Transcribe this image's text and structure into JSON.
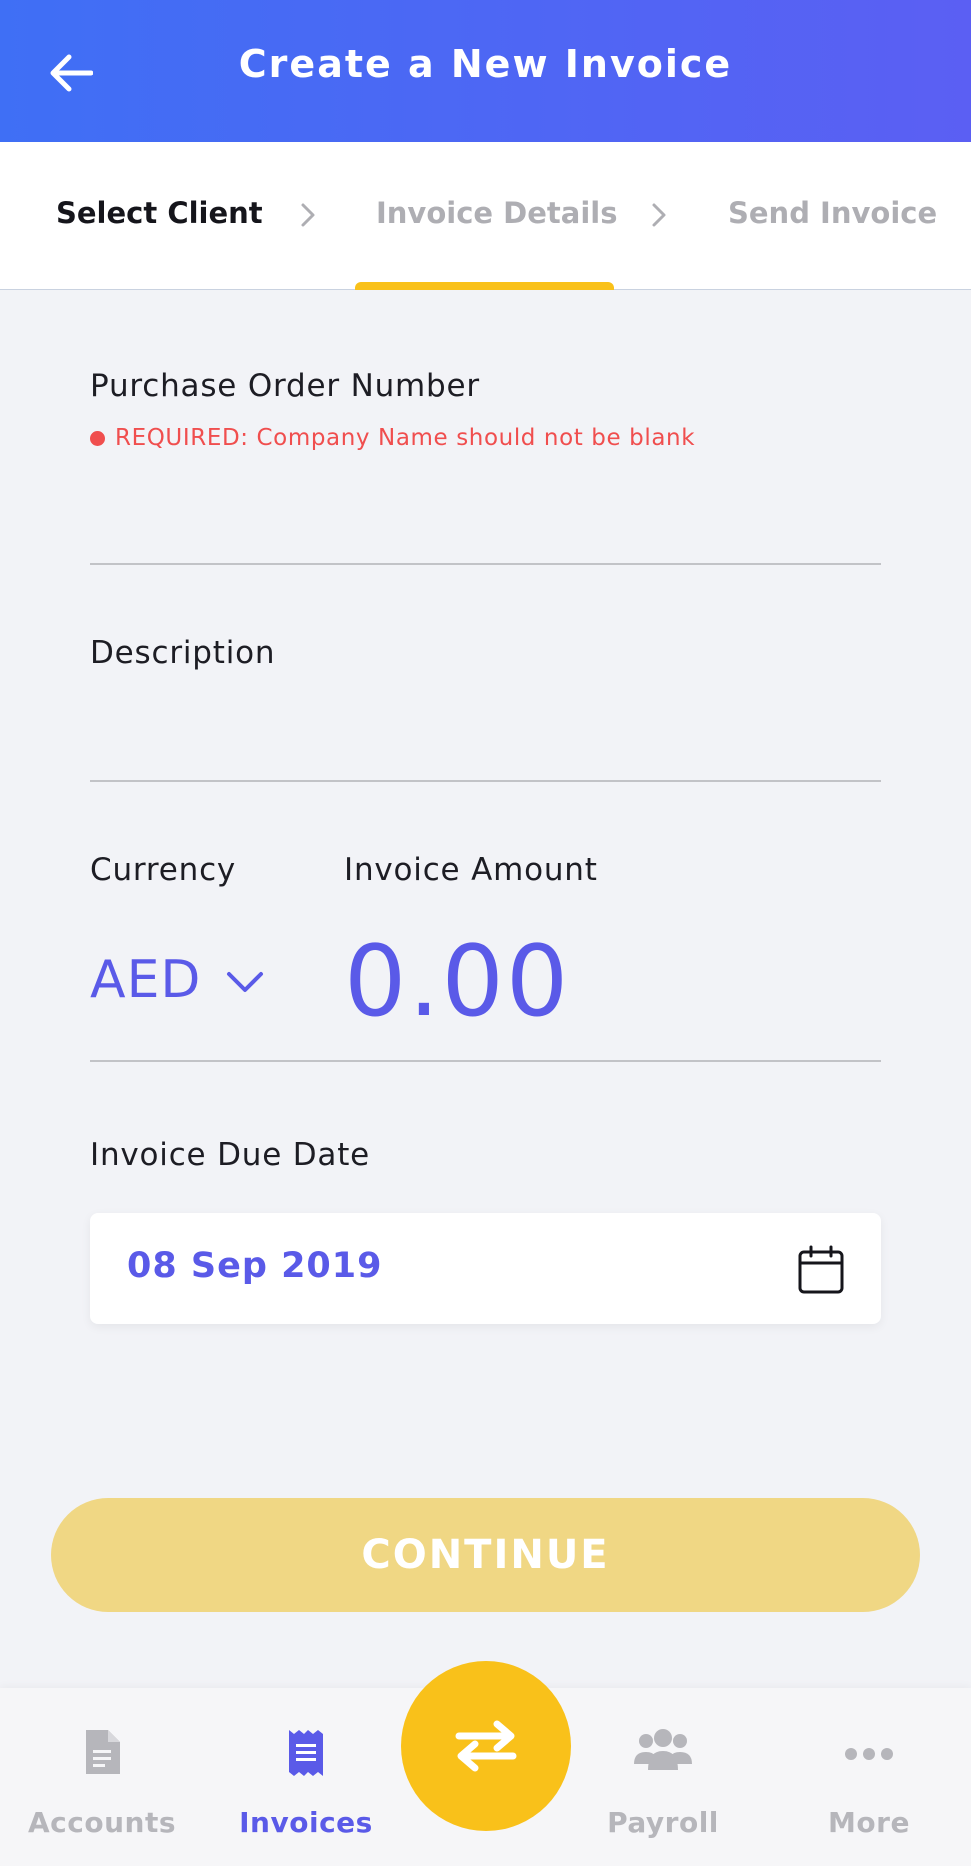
{
  "header": {
    "title": "Create a New Invoice",
    "back_icon": "arrow-left-icon"
  },
  "steps": [
    {
      "label": "Select Client",
      "state": "active"
    },
    {
      "label": "Invoice Details",
      "state": "inactive"
    },
    {
      "label": "Send Invoice",
      "state": "inactive"
    }
  ],
  "form": {
    "po_label": "Purchase Order Number",
    "po_error": "REQUIRED: Company Name should not be blank",
    "po_value": "",
    "description_label": "Description",
    "description_value": "",
    "currency_label": "Currency",
    "currency_value": "AED",
    "amount_label": "Invoice Amount",
    "amount_value": "0.00",
    "due_date_label": "Invoice Due Date",
    "due_date_value": "08 Sep 2019"
  },
  "continue_label": "CONTINUE",
  "nav": {
    "items": [
      {
        "label": "Accounts",
        "icon": "document-icon",
        "active": false
      },
      {
        "label": "Invoices",
        "icon": "receipt-icon",
        "active": true
      },
      {
        "label": "Payroll",
        "icon": "people-icon",
        "active": false
      },
      {
        "label": "More",
        "icon": "more-dots-icon",
        "active": false
      }
    ],
    "center_icon": "transfer-arrows-icon"
  },
  "colors": {
    "primary": "#5a5ae8",
    "header_start": "#3f6ff5",
    "header_end": "#5b5ff3",
    "accent": "#f9c11a",
    "error": "#f04e4e",
    "continue_disabled": "#f0d784"
  }
}
